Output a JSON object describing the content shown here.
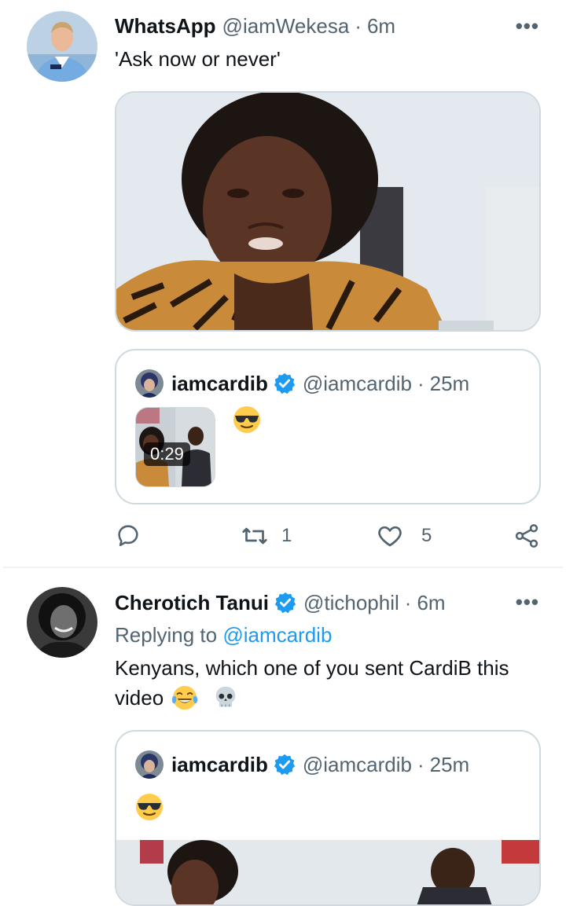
{
  "tweet1": {
    "display_name": "WhatsApp",
    "handle": "@iamWekesa",
    "sep": "·",
    "time": "6m",
    "text": "'Ask now or never'",
    "quote": {
      "display_name": "iamcardib",
      "handle": "@iamcardib",
      "sep": "·",
      "time": "25m",
      "video_duration": "0:29"
    },
    "actions": {
      "retweets": "1",
      "likes": "5"
    }
  },
  "tweet2": {
    "display_name": "Cherotich Tanui",
    "handle": "@tichophil",
    "sep": "·",
    "time": "6m",
    "replying_prefix": "Replying to",
    "replying_to": "@iamcardib",
    "text_line1": "Kenyans, which one of you sent CardiB this",
    "text_line2": "video",
    "quote": {
      "display_name": "iamcardib",
      "handle": "@iamcardib",
      "sep": "·",
      "time": "25m"
    }
  },
  "more_icon": "more-horizontal-icon",
  "colors": {
    "link": "#1d9bf0",
    "muted": "#536471",
    "border": "#cfd9de",
    "verified": "#1d9bf0"
  }
}
